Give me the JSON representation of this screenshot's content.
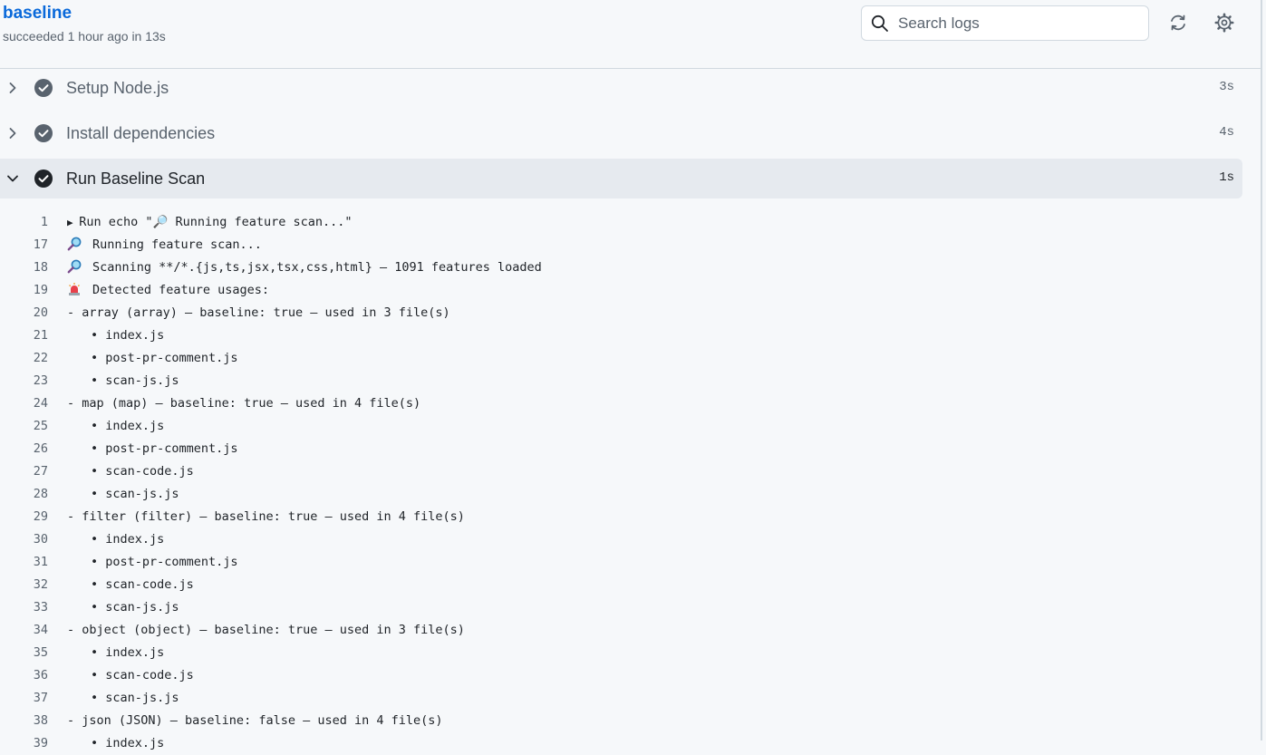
{
  "header": {
    "job_title": "baseline",
    "job_status": "succeeded 1 hour ago in 13s",
    "search_placeholder": "Search logs"
  },
  "steps": [
    {
      "label": "Setup Node.js",
      "time": "3s",
      "expanded": false
    },
    {
      "label": "Install dependencies",
      "time": "4s",
      "expanded": false
    },
    {
      "label": "Run Baseline Scan",
      "time": "1s",
      "expanded": true
    }
  ],
  "log": [
    {
      "n": "1",
      "text": "Run echo \"🔎 Running feature scan...\"",
      "kind": "group"
    },
    {
      "n": "17",
      "text": "Running feature scan...",
      "kind": "emoji-search"
    },
    {
      "n": "18",
      "text": "Scanning **/*.{js,ts,jsx,tsx,css,html} — 1091 features loaded",
      "kind": "emoji-search"
    },
    {
      "n": "19",
      "text": "Detected feature usages:",
      "kind": "emoji-siren"
    },
    {
      "n": "20",
      "text": "- array (array) — baseline: true — used in 3 file(s)",
      "kind": "plain"
    },
    {
      "n": "21",
      "text": "• index.js",
      "kind": "bullet"
    },
    {
      "n": "22",
      "text": "• post-pr-comment.js",
      "kind": "bullet"
    },
    {
      "n": "23",
      "text": "• scan-js.js",
      "kind": "bullet"
    },
    {
      "n": "24",
      "text": "- map (map) — baseline: true — used in 4 file(s)",
      "kind": "plain"
    },
    {
      "n": "25",
      "text": "• index.js",
      "kind": "bullet"
    },
    {
      "n": "26",
      "text": "• post-pr-comment.js",
      "kind": "bullet"
    },
    {
      "n": "27",
      "text": "• scan-code.js",
      "kind": "bullet"
    },
    {
      "n": "28",
      "text": "• scan-js.js",
      "kind": "bullet"
    },
    {
      "n": "29",
      "text": "- filter (filter) — baseline: true — used in 4 file(s)",
      "kind": "plain"
    },
    {
      "n": "30",
      "text": "• index.js",
      "kind": "bullet"
    },
    {
      "n": "31",
      "text": "• post-pr-comment.js",
      "kind": "bullet"
    },
    {
      "n": "32",
      "text": "• scan-code.js",
      "kind": "bullet"
    },
    {
      "n": "33",
      "text": "• scan-js.js",
      "kind": "bullet"
    },
    {
      "n": "34",
      "text": "- object (object) — baseline: true — used in 3 file(s)",
      "kind": "plain"
    },
    {
      "n": "35",
      "text": "• index.js",
      "kind": "bullet"
    },
    {
      "n": "36",
      "text": "• scan-code.js",
      "kind": "bullet"
    },
    {
      "n": "37",
      "text": "• scan-js.js",
      "kind": "bullet"
    },
    {
      "n": "38",
      "text": "- json (JSON) — baseline: false — used in 4 file(s)",
      "kind": "plain"
    },
    {
      "n": "39",
      "text": "• index.js",
      "kind": "bullet"
    }
  ],
  "icons": {
    "search": "search-icon",
    "refresh": "refresh-icon",
    "settings": "gear-icon",
    "step_check": "check-circle-icon",
    "collapsed": "chevron-right-icon",
    "expanded": "chevron-down-icon"
  },
  "colors": {
    "link": "#0969da",
    "muted": "#59636e",
    "success_collapsed": "#59636e",
    "success_expanded": "#1f2328"
  }
}
